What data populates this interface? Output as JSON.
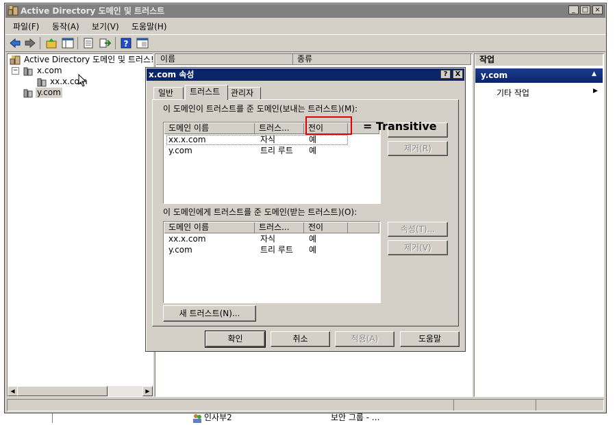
{
  "main_window": {
    "title": "Active Directory 도메인 및 트러스트",
    "menu": [
      "파일(F)",
      "동작(A)",
      "보기(V)",
      "도움말(H)"
    ]
  },
  "tree": {
    "root_label": "Active Directory 도메인 및 트러스!",
    "nodes": [
      "x.com",
      "xx.x.com",
      "y.com"
    ]
  },
  "list_header": {
    "name": "이름",
    "type": "종류"
  },
  "bottom_row": {
    "name": "인사부2",
    "type": "보안 그룹 - ..."
  },
  "actions": {
    "header": "작업",
    "section": "y.com",
    "item": "기타 작업"
  },
  "dialog": {
    "title": "x.com 속성",
    "help_btn": "?",
    "close_btn": "X",
    "tabs": [
      "일반",
      "트러스트",
      "관리자"
    ],
    "outgoing_label": "이 도메인이 트러스트를 준 도메인(보내는 트러스트)(M):",
    "incoming_label": "이 도메인에게 트러스트를 준 도메인(받는 트러스트)(O):",
    "columns": [
      "도메인 이름",
      "트러스...",
      "전이"
    ],
    "outgoing_rows": [
      {
        "domain": "xx.x.com",
        "trust": "자식",
        "transitive": "예"
      },
      {
        "domain": "y.com",
        "trust": "트리 루트",
        "transitive": "예"
      }
    ],
    "incoming_rows": [
      {
        "domain": "xx.x.com",
        "trust": "자식",
        "transitive": "예"
      },
      {
        "domain": "y.com",
        "trust": "트리 루트",
        "transitive": "예"
      }
    ],
    "outgoing_buttons": {
      "remove": "제거(R)"
    },
    "incoming_buttons": {
      "properties": "속성(T)...",
      "remove": "제거(V)"
    },
    "new_trust": "새 트러스트(N)...",
    "footer": {
      "ok": "확인",
      "cancel": "취소",
      "apply": "적용(A)",
      "help": "도움말"
    }
  },
  "annotation": {
    "text": "= Transitive",
    "color": "#e00000"
  },
  "colors": {
    "titlebar": "#808080",
    "dialog_titlebar": "#0a246a",
    "face": "#d4d0c8",
    "action_header": "#0a246a"
  }
}
